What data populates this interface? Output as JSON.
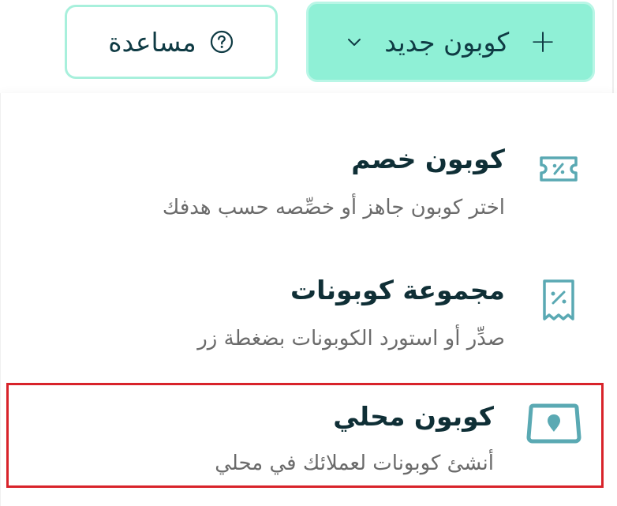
{
  "toolbar": {
    "new_coupon_label": "كوبون جديد",
    "help_label": "مساعدة",
    "accent_color": "#8ff0d6"
  },
  "menu": {
    "items": [
      {
        "title": "كوبون خصم",
        "description": "اختر كوبون جاهز أو خصِّصه حسب هدفك",
        "icon": "discount-ticket-icon"
      },
      {
        "title": "مجموعة كوبونات",
        "description": "صدِّر أو استورد الكوبونات بضغطة زر",
        "icon": "coupon-receipt-icon"
      },
      {
        "title": "كوبون محلي",
        "description": "أنشئ كوبونات لعملائك في محلي",
        "icon": "store-location-icon",
        "highlighted": true
      }
    ]
  },
  "colors": {
    "icon_color": "#5aa9b3",
    "highlight_border": "#d8232a",
    "title_color": "#0f2f36",
    "desc_color": "#6b6b6b"
  }
}
